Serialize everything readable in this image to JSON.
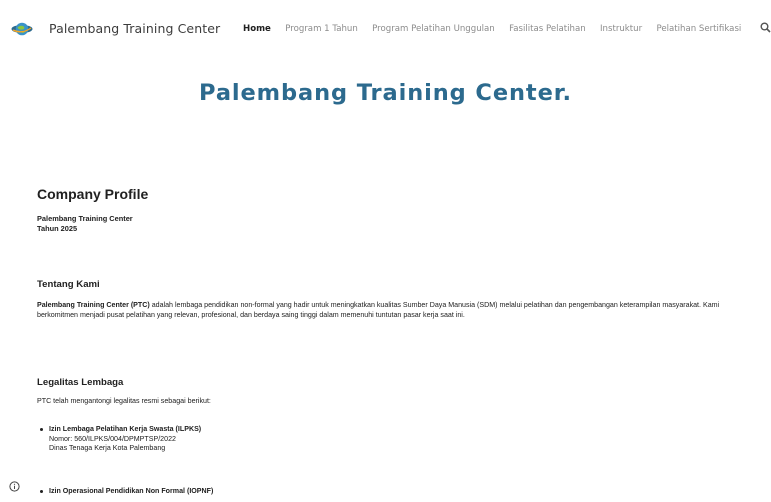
{
  "header": {
    "site_title": "Palembang Training Center",
    "logo_icon": "globe-logo-icon",
    "nav": [
      {
        "label": "Home",
        "active": true
      },
      {
        "label": "Program 1 Tahun",
        "active": false
      },
      {
        "label": "Program Pelatihan Unggulan",
        "active": false
      },
      {
        "label": "Fasilitas Pelatihan",
        "active": false
      },
      {
        "label": "Instruktur",
        "active": false
      },
      {
        "label": "Pelatihan Sertifikasi",
        "active": false
      }
    ],
    "search_icon": "search-icon"
  },
  "hero": {
    "title": "Palembang Training Center."
  },
  "profile": {
    "heading": "Company Profile",
    "org": "Palembang Training Center",
    "year": "Tahun 2025"
  },
  "about": {
    "heading": "Tentang Kami",
    "lead": "Palembang Training Center (PTC)",
    "body": " adalah lembaga pendidikan non-formal yang hadir untuk meningkatkan kualitas Sumber Daya Manusia (SDM) melalui pelatihan dan pengembangan keterampilan masyarakat. Kami berkomitmen menjadi pusat pelatihan yang relevan, profesional, dan berdaya saing tinggi dalam memenuhi tuntutan pasar kerja saat ini."
  },
  "legal": {
    "heading": "Legalitas Lembaga",
    "intro": "PTC telah mengantongi legalitas resmi sebagai berikut:",
    "items": [
      {
        "title": "Izin Lembaga Pelatihan Kerja Swasta (ILPKS)",
        "number": "Nomor: 560/ILPKS/004/DPMPTSP/2022",
        "issuer": "Dinas Tenaga Kerja Kota Palembang"
      },
      {
        "title": "Izin Operasional Pendidikan Non Formal (IOPNF)"
      }
    ]
  },
  "colors": {
    "accent_title": "#2c6a8e",
    "nav_inactive": "#8c8c8c",
    "text": "#212121"
  },
  "footer": {
    "info_icon": "info-icon"
  }
}
